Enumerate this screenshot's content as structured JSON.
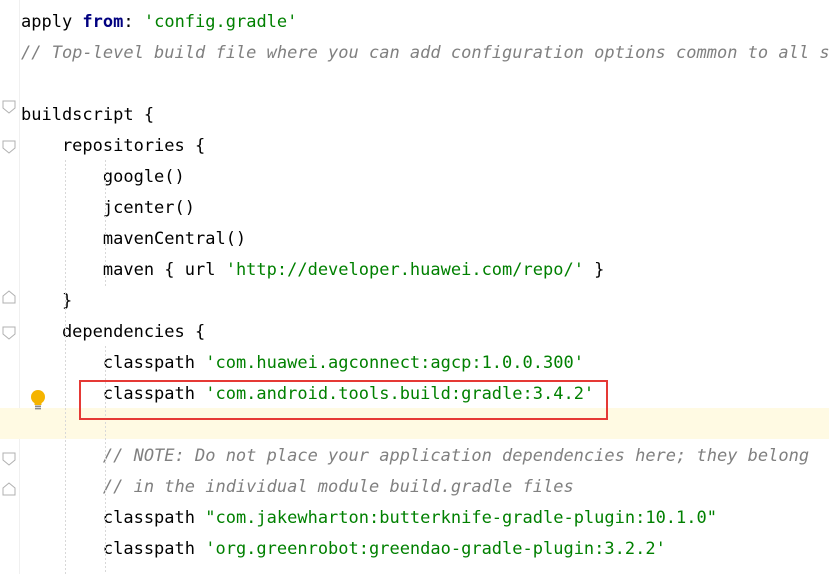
{
  "editor": {
    "lines": [
      {
        "id": "l1",
        "parts": [
          {
            "t": "apply ",
            "c": "plain"
          },
          {
            "t": "from",
            "c": "kw"
          },
          {
            "t": ": ",
            "c": "plain"
          },
          {
            "t": "'config.gradle'",
            "c": "str"
          }
        ]
      },
      {
        "id": "l2",
        "parts": [
          {
            "t": "// Top-level build file where you can add configuration options common to all sub",
            "c": "cmt"
          }
        ]
      },
      {
        "id": "l3",
        "parts": []
      },
      {
        "id": "l4",
        "parts": [
          {
            "t": "buildscript {",
            "c": "plain"
          }
        ]
      },
      {
        "id": "l5",
        "parts": [
          {
            "t": "    repositories {",
            "c": "plain"
          }
        ]
      },
      {
        "id": "l6",
        "parts": [
          {
            "t": "        google()",
            "c": "plain"
          }
        ]
      },
      {
        "id": "l7",
        "parts": [
          {
            "t": "        jcenter()",
            "c": "plain"
          }
        ]
      },
      {
        "id": "l8",
        "parts": [
          {
            "t": "        mavenCentral()",
            "c": "plain"
          }
        ]
      },
      {
        "id": "l9",
        "parts": [
          {
            "t": "        maven { url ",
            "c": "plain"
          },
          {
            "t": "'http://developer.huawei.com/repo/'",
            "c": "str"
          },
          {
            "t": " }",
            "c": "plain"
          }
        ]
      },
      {
        "id": "l10",
        "parts": [
          {
            "t": "    }",
            "c": "plain"
          }
        ]
      },
      {
        "id": "l11",
        "parts": [
          {
            "t": "    dependencies {",
            "c": "plain"
          }
        ]
      },
      {
        "id": "l12",
        "parts": [
          {
            "t": "        classpath ",
            "c": "plain"
          },
          {
            "t": "'com.huawei.agconnect:agcp:1.0.0.300'",
            "c": "str"
          }
        ]
      },
      {
        "id": "l13",
        "parts": [
          {
            "t": "        classpath ",
            "c": "plain"
          },
          {
            "t": "'com.android.tools.build:gradle:3.4.2'",
            "c": "str"
          }
        ]
      },
      {
        "id": "l14",
        "parts": []
      },
      {
        "id": "l15",
        "parts": [
          {
            "t": "        // NOTE: Do not place your application dependencies here; they belong",
            "c": "cmt"
          }
        ]
      },
      {
        "id": "l16",
        "parts": [
          {
            "t": "        // in the individual module build.gradle files",
            "c": "cmt"
          }
        ]
      },
      {
        "id": "l17",
        "parts": [
          {
            "t": "        classpath ",
            "c": "plain"
          },
          {
            "t": "\"com.jakewharton:butterknife-gradle-plugin:10.1.0\"",
            "c": "str"
          }
        ]
      },
      {
        "id": "l18",
        "parts": [
          {
            "t": "        classpath ",
            "c": "plain"
          },
          {
            "t": "'org.greenrobot:greendao-gradle-plugin:3.2.2'",
            "c": "str"
          }
        ]
      }
    ],
    "colors": {
      "keyword": "#000080",
      "string": "#008000",
      "comment": "#808080",
      "highlight_box": "#e53935",
      "caret_line": "#fffae3",
      "bulb": "#f5b400"
    },
    "icons": {
      "intention_bulb": "lightbulb-icon",
      "fold_open": "fold-open-icon",
      "fold_close": "fold-close-icon"
    }
  }
}
